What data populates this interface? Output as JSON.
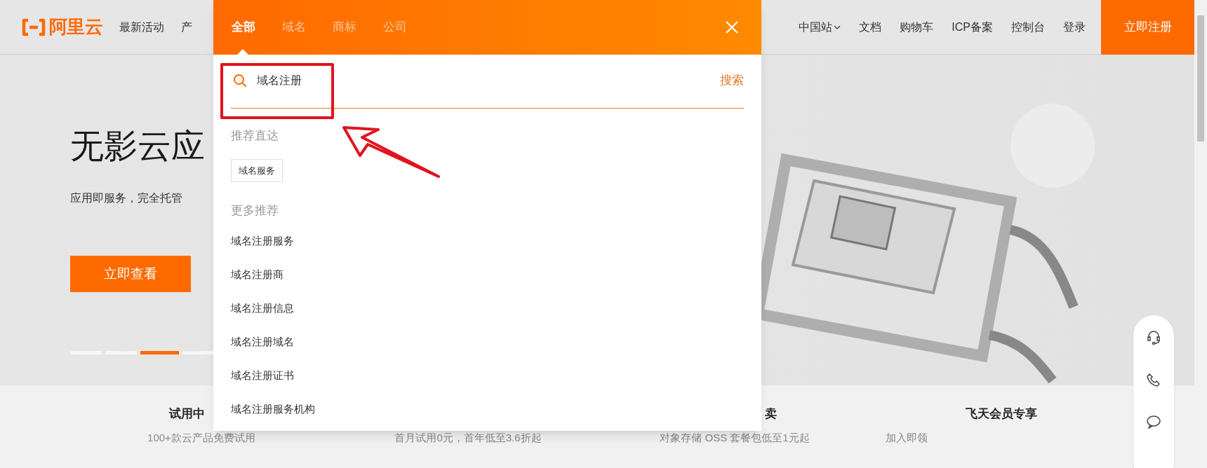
{
  "header": {
    "logo_text": "阿里云",
    "nav_left": [
      "最新活动",
      "产"
    ],
    "region": "中国站",
    "nav_right": [
      "文档",
      "购物车",
      "ICP备案",
      "控制台",
      "登录"
    ],
    "signup_button": "立即注册"
  },
  "hero": {
    "title": "无影云应",
    "subtitle": "应用即服务，完全托管",
    "cta": "立即查看",
    "slides": [
      {
        "selected": false
      },
      {
        "selected": false
      },
      {
        "selected": true
      },
      {
        "selected": false
      }
    ]
  },
  "features": [
    {
      "title": "试用中",
      "subtitle": "100+款云产品免费试用"
    },
    {
      "subtitle": "首月试用0元，首年低至3.6折起"
    },
    {
      "title": "卖",
      "subtitle": "对象存储 OSS 套餐包低至1元起"
    },
    {
      "title": "飞天会员专享",
      "subtitle": "加入即领"
    }
  ],
  "search_panel": {
    "tabs": [
      {
        "label": "全部",
        "selected": true
      },
      {
        "label": "域名",
        "selected": false
      },
      {
        "label": "商标",
        "selected": false
      },
      {
        "label": "公司",
        "selected": false
      }
    ],
    "query": "域名注册",
    "search_button": "搜索",
    "quick_heading": "推荐直达",
    "quick_links": [
      "域名服务"
    ],
    "more_heading": "更多推荐",
    "suggestions": [
      "域名注册服务",
      "域名注册商",
      "域名注册信息",
      "域名注册域名",
      "域名注册证书",
      "域名注册服务机构"
    ]
  }
}
